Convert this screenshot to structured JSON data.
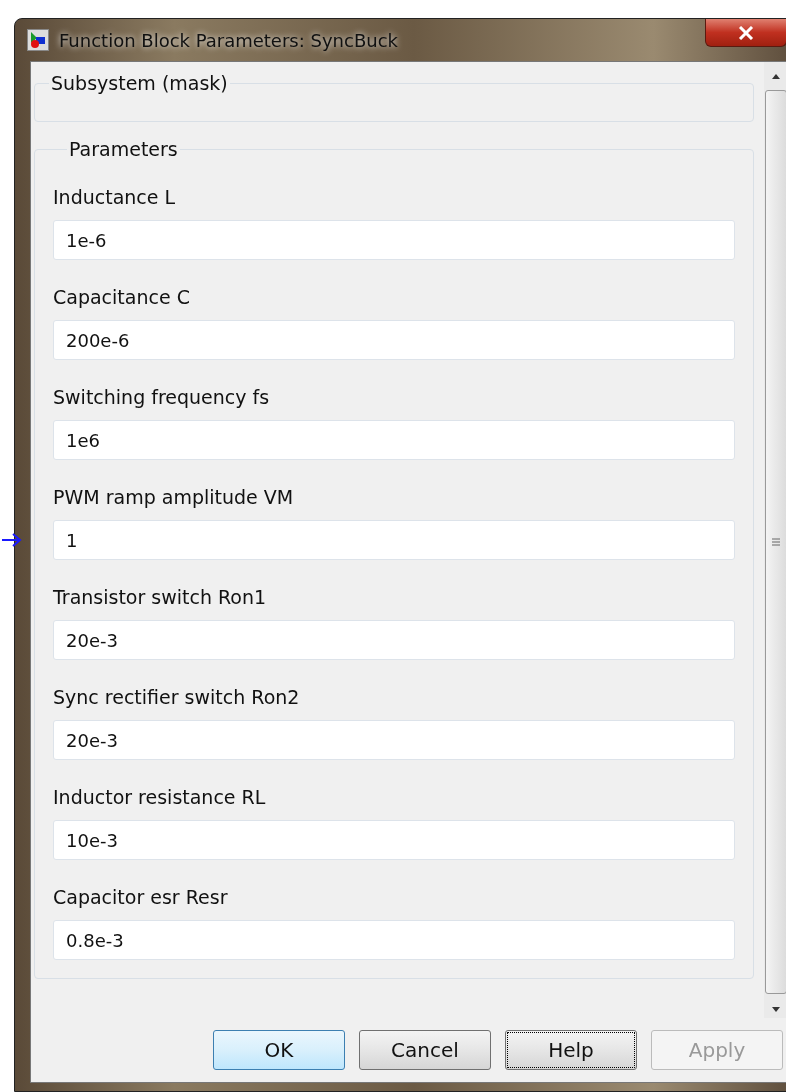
{
  "window": {
    "title": "Function Block Parameters: SyncBuck"
  },
  "mask_group": {
    "title": "Subsystem (mask)"
  },
  "parameters": {
    "title": "Parameters",
    "fields": [
      {
        "label": "Inductance L",
        "value": "1e-6",
        "marked": false
      },
      {
        "label": "Capacitance C",
        "value": "200e-6",
        "marked": false
      },
      {
        "label": "Switching frequency fs",
        "value": "1e6",
        "marked": false
      },
      {
        "label": "PWM ramp amplitude VM",
        "value": "1",
        "marked": true
      },
      {
        "label": "Transistor switch Ron1",
        "value": "20e-3",
        "marked": false
      },
      {
        "label": "Sync rectifier switch Ron2",
        "value": "20e-3",
        "marked": false
      },
      {
        "label": "Inductor resistance RL",
        "value": "10e-3",
        "marked": false
      },
      {
        "label": "Capacitor esr Resr",
        "value": "0.8e-3",
        "marked": false
      }
    ]
  },
  "buttons": [
    {
      "label": "OK",
      "hovered": true,
      "focused": false,
      "disabled": false
    },
    {
      "label": "Cancel",
      "hovered": false,
      "focused": false,
      "disabled": false
    },
    {
      "label": "Help",
      "hovered": false,
      "focused": true,
      "disabled": false
    },
    {
      "label": "Apply",
      "hovered": false,
      "focused": false,
      "disabled": true
    }
  ]
}
